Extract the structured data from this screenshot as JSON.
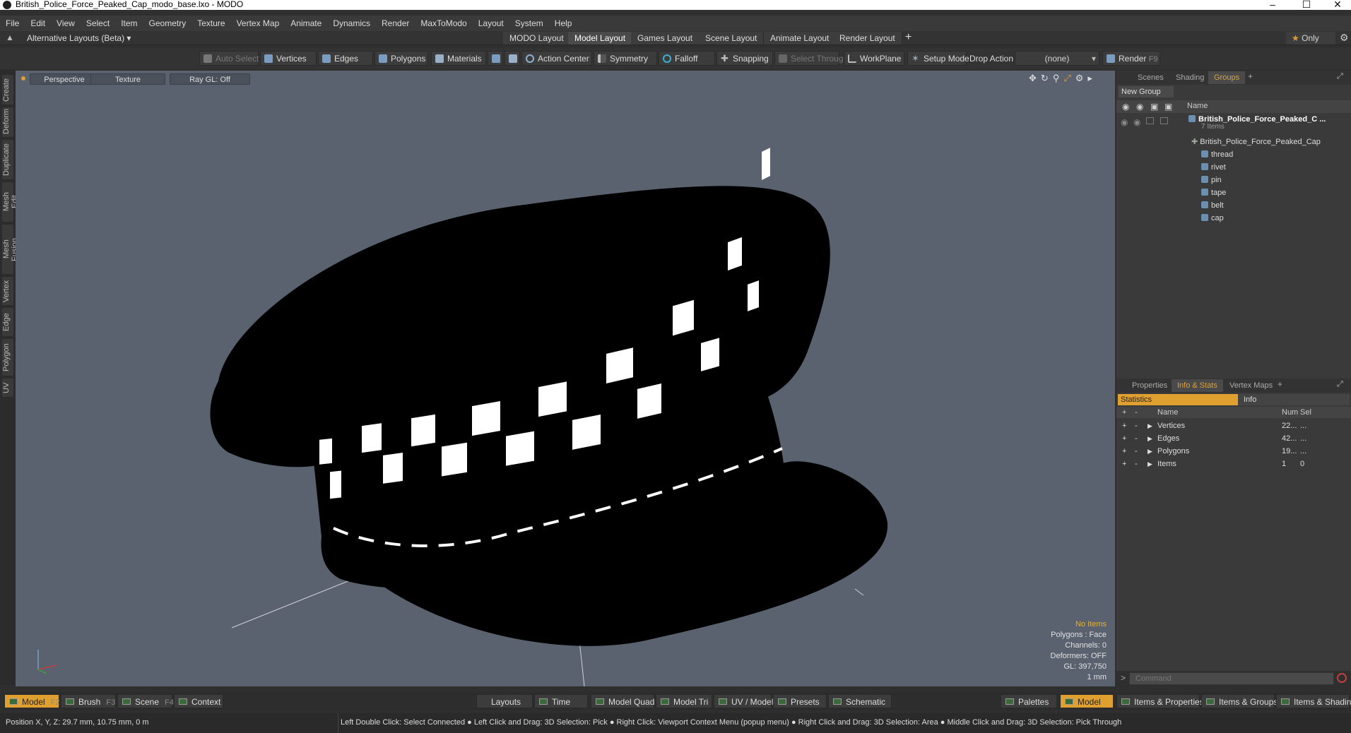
{
  "window": {
    "title": "British_Police_Force_Peaked_Cap_modo_base.lxo - MODO",
    "minimize_icon": "minimize-icon",
    "maximize_icon": "maximize-icon",
    "close_icon": "close-icon"
  },
  "menu": [
    "File",
    "Edit",
    "View",
    "Select",
    "Item",
    "Geometry",
    "Texture",
    "Vertex Map",
    "Animate",
    "Dynamics",
    "Render",
    "MaxToModo",
    "Layout",
    "System",
    "Help"
  ],
  "layoutbar": {
    "layouts_label": "Alternative Layouts (Beta)",
    "tabs": [
      "MODO Layout",
      "Model Layout",
      "Games Layout",
      "Scene Layout",
      "Animate Layout",
      "Render Layout"
    ],
    "active_tab": "Model Layout",
    "add": "+",
    "only": "Only"
  },
  "toolbar": {
    "auto_select": "Auto Select",
    "vertices": "Vertices",
    "edges": "Edges",
    "polygons": "Polygons",
    "materials": "Materials",
    "action_center": "Action Center",
    "symmetry": "Symmetry",
    "falloff": "Falloff",
    "snapping": "Snapping",
    "select_through": "Select Through",
    "workplane": "WorkPlane",
    "setup_mode": "Setup Mode",
    "drop_action_label": "Drop Action",
    "drop_action_value": "(none)",
    "render": "Render",
    "render_key": "F9"
  },
  "left_tabs": [
    "Create",
    "Deform",
    "Duplicate",
    "Mesh Edit",
    "Mesh Fusion",
    "Vertex",
    "Edge",
    "Polygon",
    "UV"
  ],
  "viewport": {
    "view": "Perspective",
    "shading": "Texture",
    "raygl": "Ray GL: Off",
    "stats": {
      "no_items": "No Items",
      "polygons": "Polygons : Face",
      "channels": "Channels: 0",
      "deformers": "Deformers: OFF",
      "gl": "GL: 397,750",
      "unit": "1 mm"
    }
  },
  "groups_panel": {
    "tabs": [
      "Scenes",
      "Shading",
      "Groups"
    ],
    "active_tab": "Groups",
    "new_group": "New Group",
    "name_header": "Name",
    "root": {
      "name": "British_Police_Force_Peaked_C ...",
      "count": "7 Items"
    },
    "items": [
      "British_Police_Force_Peaked_Cap",
      "thread",
      "rivet",
      "pin",
      "tape",
      "belt",
      "cap"
    ]
  },
  "info_panel": {
    "tabs": [
      "Properties",
      "Info & Stats",
      "Vertex Maps"
    ],
    "active_tab": "Info & Stats",
    "sub_tabs": [
      "Statistics",
      "Info"
    ],
    "headers": {
      "name": "Name",
      "num": "Num",
      "sel": "Sel"
    },
    "rows": [
      {
        "name": "Vertices",
        "num": "22...",
        "sel": "..."
      },
      {
        "name": "Edges",
        "num": "42...",
        "sel": "..."
      },
      {
        "name": "Polygons",
        "num": "19...",
        "sel": "..."
      },
      {
        "name": "Items",
        "num": "1",
        "sel": "0"
      }
    ],
    "command_placeholder": "Command"
  },
  "bottombar": {
    "model": "Model",
    "model_key": "F2",
    "brush": "Brush",
    "brush_key": "F3",
    "scene": "Scene",
    "scene_key": "F4",
    "context": "Context",
    "layouts": "Layouts",
    "time": "Time",
    "model_quad": "Model Quad",
    "model_tri": "Model Tri",
    "uv_model": "UV / Model",
    "presets": "Presets",
    "schematic": "Schematic",
    "palettes": "Palettes",
    "model_right": "Model",
    "items_properties": "Items & Properties",
    "items_groups": "Items & Groups",
    "items_shading": "Items & Shading"
  },
  "status": {
    "position": "Position X, Y, Z:  29.7 mm, 10.75 mm, 0 m",
    "hints": "Left Double Click: Select Connected ● Left Click and Drag: 3D Selection: Pick ● Right Click: Viewport Context Menu (popup menu) ● Right Click and Drag: 3D Selection: Area ● Middle Click and Drag: 3D Selection: Pick Through"
  }
}
